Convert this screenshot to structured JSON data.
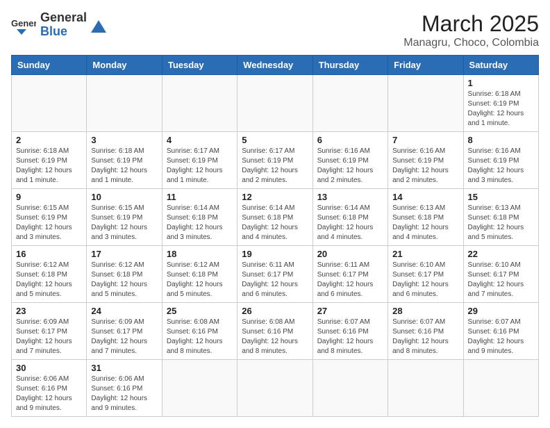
{
  "logo": {
    "text_general": "General",
    "text_blue": "Blue"
  },
  "header": {
    "month": "March 2025",
    "location": "Managru, Choco, Colombia"
  },
  "days_of_week": [
    "Sunday",
    "Monday",
    "Tuesday",
    "Wednesday",
    "Thursday",
    "Friday",
    "Saturday"
  ],
  "weeks": [
    [
      {
        "day": "",
        "info": ""
      },
      {
        "day": "",
        "info": ""
      },
      {
        "day": "",
        "info": ""
      },
      {
        "day": "",
        "info": ""
      },
      {
        "day": "",
        "info": ""
      },
      {
        "day": "",
        "info": ""
      },
      {
        "day": "1",
        "info": "Sunrise: 6:18 AM\nSunset: 6:19 PM\nDaylight: 12 hours and 1 minute."
      }
    ],
    [
      {
        "day": "2",
        "info": "Sunrise: 6:18 AM\nSunset: 6:19 PM\nDaylight: 12 hours and 1 minute."
      },
      {
        "day": "3",
        "info": "Sunrise: 6:18 AM\nSunset: 6:19 PM\nDaylight: 12 hours and 1 minute."
      },
      {
        "day": "4",
        "info": "Sunrise: 6:17 AM\nSunset: 6:19 PM\nDaylight: 12 hours and 1 minute."
      },
      {
        "day": "5",
        "info": "Sunrise: 6:17 AM\nSunset: 6:19 PM\nDaylight: 12 hours and 2 minutes."
      },
      {
        "day": "6",
        "info": "Sunrise: 6:16 AM\nSunset: 6:19 PM\nDaylight: 12 hours and 2 minutes."
      },
      {
        "day": "7",
        "info": "Sunrise: 6:16 AM\nSunset: 6:19 PM\nDaylight: 12 hours and 2 minutes."
      },
      {
        "day": "8",
        "info": "Sunrise: 6:16 AM\nSunset: 6:19 PM\nDaylight: 12 hours and 3 minutes."
      }
    ],
    [
      {
        "day": "9",
        "info": "Sunrise: 6:15 AM\nSunset: 6:19 PM\nDaylight: 12 hours and 3 minutes."
      },
      {
        "day": "10",
        "info": "Sunrise: 6:15 AM\nSunset: 6:19 PM\nDaylight: 12 hours and 3 minutes."
      },
      {
        "day": "11",
        "info": "Sunrise: 6:14 AM\nSunset: 6:18 PM\nDaylight: 12 hours and 3 minutes."
      },
      {
        "day": "12",
        "info": "Sunrise: 6:14 AM\nSunset: 6:18 PM\nDaylight: 12 hours and 4 minutes."
      },
      {
        "day": "13",
        "info": "Sunrise: 6:14 AM\nSunset: 6:18 PM\nDaylight: 12 hours and 4 minutes."
      },
      {
        "day": "14",
        "info": "Sunrise: 6:13 AM\nSunset: 6:18 PM\nDaylight: 12 hours and 4 minutes."
      },
      {
        "day": "15",
        "info": "Sunrise: 6:13 AM\nSunset: 6:18 PM\nDaylight: 12 hours and 5 minutes."
      }
    ],
    [
      {
        "day": "16",
        "info": "Sunrise: 6:12 AM\nSunset: 6:18 PM\nDaylight: 12 hours and 5 minutes."
      },
      {
        "day": "17",
        "info": "Sunrise: 6:12 AM\nSunset: 6:18 PM\nDaylight: 12 hours and 5 minutes."
      },
      {
        "day": "18",
        "info": "Sunrise: 6:12 AM\nSunset: 6:18 PM\nDaylight: 12 hours and 5 minutes."
      },
      {
        "day": "19",
        "info": "Sunrise: 6:11 AM\nSunset: 6:17 PM\nDaylight: 12 hours and 6 minutes."
      },
      {
        "day": "20",
        "info": "Sunrise: 6:11 AM\nSunset: 6:17 PM\nDaylight: 12 hours and 6 minutes."
      },
      {
        "day": "21",
        "info": "Sunrise: 6:10 AM\nSunset: 6:17 PM\nDaylight: 12 hours and 6 minutes."
      },
      {
        "day": "22",
        "info": "Sunrise: 6:10 AM\nSunset: 6:17 PM\nDaylight: 12 hours and 7 minutes."
      }
    ],
    [
      {
        "day": "23",
        "info": "Sunrise: 6:09 AM\nSunset: 6:17 PM\nDaylight: 12 hours and 7 minutes."
      },
      {
        "day": "24",
        "info": "Sunrise: 6:09 AM\nSunset: 6:17 PM\nDaylight: 12 hours and 7 minutes."
      },
      {
        "day": "25",
        "info": "Sunrise: 6:08 AM\nSunset: 6:16 PM\nDaylight: 12 hours and 8 minutes."
      },
      {
        "day": "26",
        "info": "Sunrise: 6:08 AM\nSunset: 6:16 PM\nDaylight: 12 hours and 8 minutes."
      },
      {
        "day": "27",
        "info": "Sunrise: 6:07 AM\nSunset: 6:16 PM\nDaylight: 12 hours and 8 minutes."
      },
      {
        "day": "28",
        "info": "Sunrise: 6:07 AM\nSunset: 6:16 PM\nDaylight: 12 hours and 8 minutes."
      },
      {
        "day": "29",
        "info": "Sunrise: 6:07 AM\nSunset: 6:16 PM\nDaylight: 12 hours and 9 minutes."
      }
    ],
    [
      {
        "day": "30",
        "info": "Sunrise: 6:06 AM\nSunset: 6:16 PM\nDaylight: 12 hours and 9 minutes."
      },
      {
        "day": "31",
        "info": "Sunrise: 6:06 AM\nSunset: 6:16 PM\nDaylight: 12 hours and 9 minutes."
      },
      {
        "day": "",
        "info": ""
      },
      {
        "day": "",
        "info": ""
      },
      {
        "day": "",
        "info": ""
      },
      {
        "day": "",
        "info": ""
      },
      {
        "day": "",
        "info": ""
      }
    ]
  ]
}
